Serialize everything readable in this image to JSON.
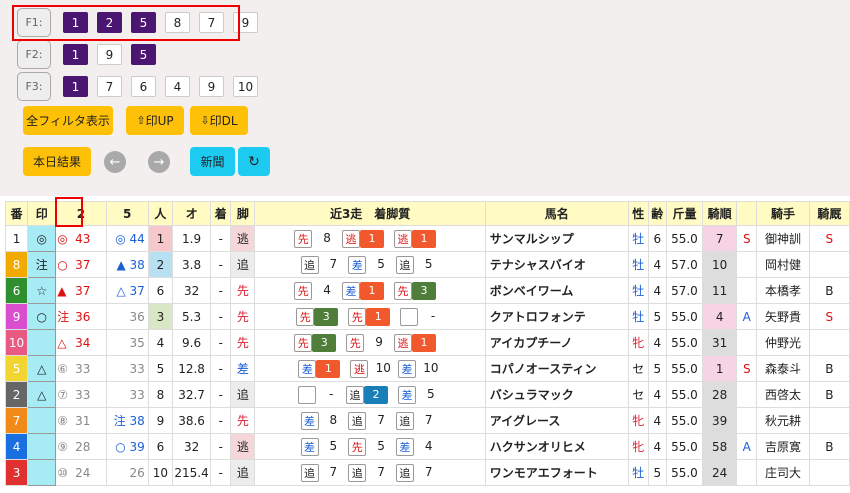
{
  "filters": [
    {
      "label": "F1:",
      "chips": [
        {
          "v": "1",
          "on": true
        },
        {
          "v": "2",
          "on": true
        },
        {
          "v": "5",
          "on": true
        },
        {
          "v": "8",
          "on": false
        },
        {
          "v": "7",
          "on": false
        },
        {
          "v": "9",
          "on": false
        }
      ]
    },
    {
      "label": "F2:",
      "chips": [
        {
          "v": "1",
          "on": true
        },
        {
          "v": "9",
          "on": false
        },
        {
          "v": "5",
          "on": true
        }
      ]
    },
    {
      "label": "F3:",
      "chips": [
        {
          "v": "1",
          "on": true
        },
        {
          "v": "7",
          "on": false
        },
        {
          "v": "6",
          "on": false
        },
        {
          "v": "4",
          "on": false
        },
        {
          "v": "9",
          "on": false
        },
        {
          "v": "10",
          "on": false
        }
      ]
    }
  ],
  "buttons": {
    "show_all": "全フィルタ表示",
    "upload": "印UP",
    "download": "印DL",
    "today_results": "本日結果",
    "prev": "←",
    "next": "→",
    "news": "新聞",
    "refresh": "↻"
  },
  "headers": [
    "番",
    "印",
    "2",
    "",
    "5",
    "",
    "人",
    "オ",
    "着",
    "脚",
    "近3走　着脚質",
    "馬名",
    "性",
    "齢",
    "斤量",
    "騎順",
    "",
    "騎手",
    "騎厩"
  ],
  "colors": {
    "waku": [
      "#fff",
      "#f2a900",
      "#2f8f2f",
      "#d94fd0",
      "#e85a82",
      "#f2d531",
      "#666",
      "#f28a1a",
      "#1a6fe0",
      "#e03030"
    ]
  },
  "rows": [
    {
      "no": "1",
      "waku": 0,
      "mark": "◎",
      "m2": "◎",
      "p2": "43",
      "m5": "◎",
      "p5": "44",
      "pop": "1",
      "odds": "1.9",
      "chaku": "-",
      "kyaku": "逃",
      "r1m": "先",
      "r1p": "8",
      "r2m": "逃",
      "r2p": "1",
      "r3m": "逃",
      "r3p": "1",
      "name": "サンマルシップ",
      "sex": "牡",
      "age": "6",
      "kin": "55.0",
      "jr": "7",
      "js": "S",
      "jockey": "御神訓",
      "stb": "S"
    },
    {
      "no": "8",
      "waku": 1,
      "mark": "注",
      "m2": "○",
      "p2": "37",
      "m5": "▲",
      "p5": "38",
      "pop": "2",
      "odds": "3.8",
      "chaku": "-",
      "kyaku": "追",
      "r1m": "追",
      "r1p": "7",
      "r2m": "差",
      "r2p": "5",
      "r3m": "追",
      "r3p": "5",
      "name": "テナシャスバイオ",
      "sex": "牡",
      "age": "4",
      "kin": "57.0",
      "jr": "10",
      "js": "",
      "jockey": "岡村健",
      "stb": ""
    },
    {
      "no": "6",
      "waku": 2,
      "mark": "☆",
      "m2": "▲",
      "p2": "37",
      "m5": "△",
      "p5": "37",
      "pop": "6",
      "odds": "32",
      "chaku": "-",
      "kyaku": "先",
      "r1m": "先",
      "r1p": "4",
      "r2m": "差",
      "r2p": "1",
      "r3m": "先",
      "r3p": "3",
      "name": "ボンベイワーム",
      "sex": "牡",
      "age": "4",
      "kin": "57.0",
      "jr": "11",
      "js": "",
      "jockey": "本橋孝",
      "stb": "B"
    },
    {
      "no": "9",
      "waku": 3,
      "mark": "○",
      "m2": "注",
      "p2": "36",
      "m5": "",
      "p5": "36",
      "pop": "3",
      "odds": "5.3",
      "chaku": "-",
      "kyaku": "先",
      "r1m": "先",
      "r1p": "3",
      "r2m": "先",
      "r2p": "1",
      "r3m": "",
      "r3p": "-",
      "name": "クアトロフォンテ",
      "sex": "牡",
      "age": "5",
      "kin": "55.0",
      "jr": "4",
      "js": "A",
      "jockey": "矢野貴",
      "stb": "S"
    },
    {
      "no": "10",
      "waku": 4,
      "mark": "",
      "m2": "△",
      "p2": "34",
      "m5": "",
      "p5": "35",
      "pop": "4",
      "odds": "9.6",
      "chaku": "-",
      "kyaku": "先",
      "r1m": "先",
      "r1p": "3",
      "r2m": "先",
      "r2p": "9",
      "r3m": "逃",
      "r3p": "1",
      "name": "アイカプチーノ",
      "sex": "牝",
      "age": "4",
      "kin": "55.0",
      "jr": "31",
      "js": "",
      "jockey": "仲野光",
      "stb": ""
    },
    {
      "no": "5",
      "waku": 5,
      "mark": "△",
      "m2": "⑥",
      "p2": "33",
      "m5": "",
      "p5": "33",
      "pop": "5",
      "odds": "12.8",
      "chaku": "-",
      "kyaku": "差",
      "r1m": "差",
      "r1p": "1",
      "r2m": "逃",
      "r2p": "10",
      "r3m": "差",
      "r3p": "10",
      "name": "コパノオースティン",
      "sex": "セ",
      "age": "5",
      "kin": "55.0",
      "jr": "1",
      "js": "S",
      "jockey": "森泰斗",
      "stb": "B"
    },
    {
      "no": "2",
      "waku": 6,
      "mark": "△",
      "m2": "⑦",
      "p2": "33",
      "m5": "",
      "p5": "33",
      "pop": "8",
      "odds": "32.7",
      "chaku": "-",
      "kyaku": "追",
      "r1m": "",
      "r1p": "-",
      "r2m": "追",
      "r2p": "2",
      "r3m": "差",
      "r3p": "5",
      "name": "バシュラマック",
      "sex": "セ",
      "age": "4",
      "kin": "55.0",
      "jr": "28",
      "js": "",
      "jockey": "西啓太",
      "stb": "B"
    },
    {
      "no": "7",
      "waku": 7,
      "mark": "",
      "m2": "⑧",
      "p2": "31",
      "m5": "注",
      "p5": "38",
      "pop": "9",
      "odds": "38.6",
      "chaku": "-",
      "kyaku": "先",
      "r1m": "差",
      "r1p": "8",
      "r2m": "追",
      "r2p": "7",
      "r3m": "追",
      "r3p": "7",
      "name": "アイグレース",
      "sex": "牝",
      "age": "4",
      "kin": "55.0",
      "jr": "39",
      "js": "",
      "jockey": "秋元耕",
      "stb": ""
    },
    {
      "no": "4",
      "waku": 8,
      "mark": "",
      "m2": "⑨",
      "p2": "28",
      "m5": "○",
      "p5": "39",
      "pop": "6",
      "odds": "32",
      "chaku": "-",
      "kyaku": "逃",
      "r1m": "差",
      "r1p": "5",
      "r2m": "先",
      "r2p": "5",
      "r3m": "差",
      "r3p": "4",
      "name": "ハクサンオリヒメ",
      "sex": "牝",
      "age": "4",
      "kin": "55.0",
      "jr": "58",
      "js": "A",
      "jockey": "吉原寛",
      "stb": "B"
    },
    {
      "no": "3",
      "waku": 9,
      "mark": "",
      "m2": "⑩",
      "p2": "24",
      "m5": "",
      "p5": "26",
      "pop": "10",
      "odds": "215.4",
      "chaku": "-",
      "kyaku": "追",
      "r1m": "追",
      "r1p": "7",
      "r2m": "追",
      "r2p": "7",
      "r3m": "追",
      "r3p": "7",
      "name": "ワンモアエフォート",
      "sex": "牡",
      "age": "5",
      "kin": "55.0",
      "jr": "24",
      "js": "",
      "jockey": "庄司大",
      "stb": ""
    }
  ]
}
